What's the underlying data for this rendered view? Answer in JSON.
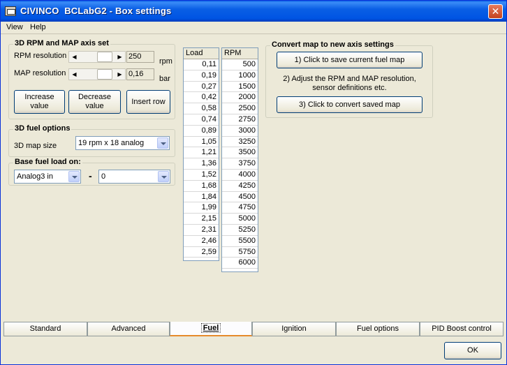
{
  "window": {
    "title": "CIVINCO  BCLabG2 - Box settings",
    "close_symbol": "✕"
  },
  "menu": [
    {
      "label": "View"
    },
    {
      "label": "Help"
    }
  ],
  "axis_group": {
    "title": "3D RPM and MAP axis set",
    "rpm_label": "RPM resolution",
    "rpm_value": "250",
    "rpm_unit": "rpm",
    "map_label": "MAP resolution",
    "map_value": "0,16",
    "map_unit": "bar",
    "increase_label": "Increase value",
    "decrease_label": "Decrease value",
    "insert_row_label": "Insert row"
  },
  "fuel_options_group": {
    "title": "3D fuel options",
    "map_size_label": "3D map size",
    "map_size_value": "19 rpm x 18 analog"
  },
  "base_fuel_group": {
    "title": "Base fuel load on:",
    "source_value": "Analog3 in",
    "dash": "-",
    "second_value": "0"
  },
  "load_list": {
    "header": "Load",
    "values": [
      "0,11",
      "0,19",
      "0,27",
      "0,42",
      "0,58",
      "0,74",
      "0,89",
      "1,05",
      "1,21",
      "1,36",
      "1,52",
      "1,68",
      "1,84",
      "1,99",
      "2,15",
      "2,31",
      "2,46",
      "2,59"
    ]
  },
  "rpm_list": {
    "header": "RPM",
    "values": [
      "500",
      "1000",
      "1500",
      "2000",
      "2500",
      "2750",
      "3000",
      "3250",
      "3500",
      "3750",
      "4000",
      "4250",
      "4500",
      "4750",
      "5000",
      "5250",
      "5500",
      "5750",
      "6000"
    ]
  },
  "convert_group": {
    "title": "Convert map to new axis settings",
    "step1_label": "1) Click to save current fuel map",
    "step2_text": "2) Adjust the RPM and MAP resolution, sensor definitions etc.",
    "step3_label": "3) Click to convert saved map"
  },
  "tabs": [
    {
      "label": "Standard",
      "active": false
    },
    {
      "label": "Advanced",
      "active": false
    },
    {
      "label": "Fuel",
      "active": true
    },
    {
      "label": "Ignition",
      "active": false
    },
    {
      "label": "Fuel options",
      "active": false
    },
    {
      "label": "PID Boost control",
      "active": false
    }
  ],
  "ok_label": "OK"
}
